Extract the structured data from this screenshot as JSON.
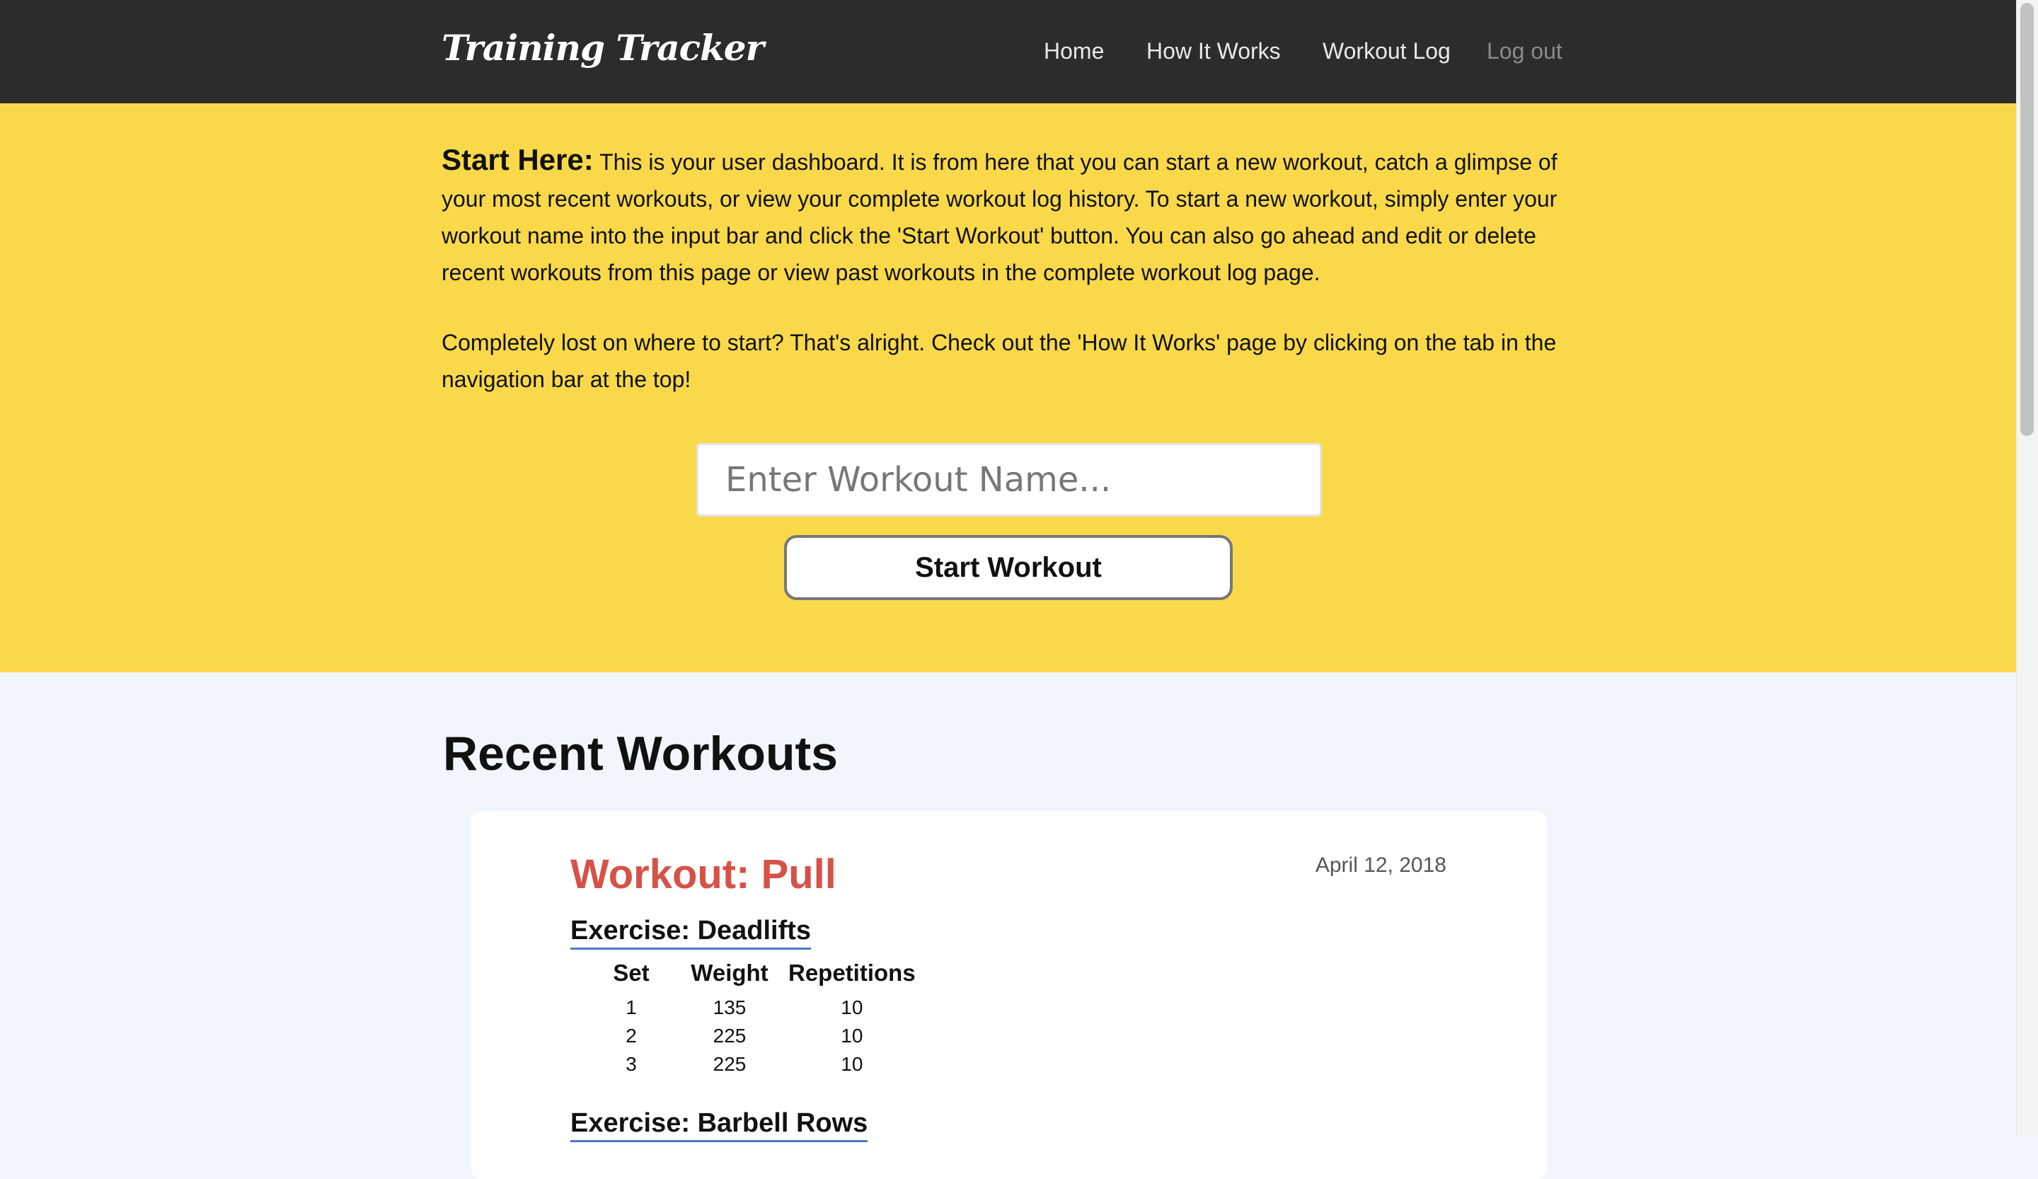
{
  "navbar": {
    "brand": "Training Tracker",
    "links": [
      {
        "label": "Home"
      },
      {
        "label": "How It Works"
      },
      {
        "label": "Workout Log"
      },
      {
        "label": "Log out"
      }
    ]
  },
  "hero": {
    "intro_title": "Start Here:",
    "intro_text": "This is your user dashboard. It is from here that you can start a new workout, catch a glimpse of your most recent workouts, or view your complete workout log history. To start a new workout, simply enter your workout name into the input bar and click the 'Start Workout' button. You can also go ahead and edit or delete recent workouts from this page or view past workouts in the complete workout log page.",
    "lost_text": "Completely lost on where to start? That's alright. Check out the 'How It Works' page by clicking on the tab in the navigation bar at the top!",
    "input_placeholder": "Enter Workout Name...",
    "start_button": "Start Workout"
  },
  "recent": {
    "heading": "Recent Workouts",
    "workouts": [
      {
        "title": "Workout: Pull",
        "date": "April 12, 2018",
        "exercises": [
          {
            "name": "Exercise: Deadlifts",
            "columns": [
              "Set",
              "Weight",
              "Repetitions"
            ],
            "rows": [
              [
                "1",
                "135",
                "10"
              ],
              [
                "2",
                "225",
                "10"
              ],
              [
                "3",
                "225",
                "10"
              ]
            ]
          },
          {
            "name": "Exercise: Barbell Rows"
          }
        ]
      }
    ]
  },
  "colors": {
    "navbar_bg": "#2c2c2c",
    "hero_bg": "#f9d84a",
    "page_bg": "#f1f6fc",
    "workout_title": "#d65247",
    "exercise_underline": "#4a79c9"
  }
}
